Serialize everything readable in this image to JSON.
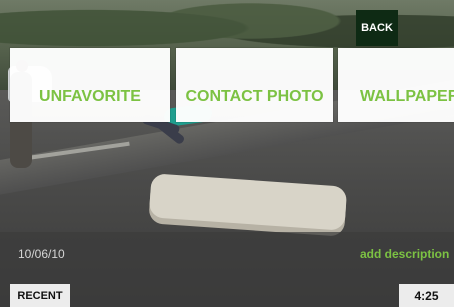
{
  "top_bar": {
    "back_label": "BACK"
  },
  "actions": {
    "unfavorite": "UNFAVORITE",
    "contact_photo": "CONTACT PHOTO",
    "wallpaper": "WALLPAPER"
  },
  "photo_info": {
    "date": "10/06/10",
    "add_description": "add description"
  },
  "bottom_bar": {
    "recent_label": "RECENT",
    "time": "4:25"
  },
  "colors": {
    "accent": "#7cc243",
    "tile_background": "#ffffff",
    "back_button": "#0e2a14"
  }
}
